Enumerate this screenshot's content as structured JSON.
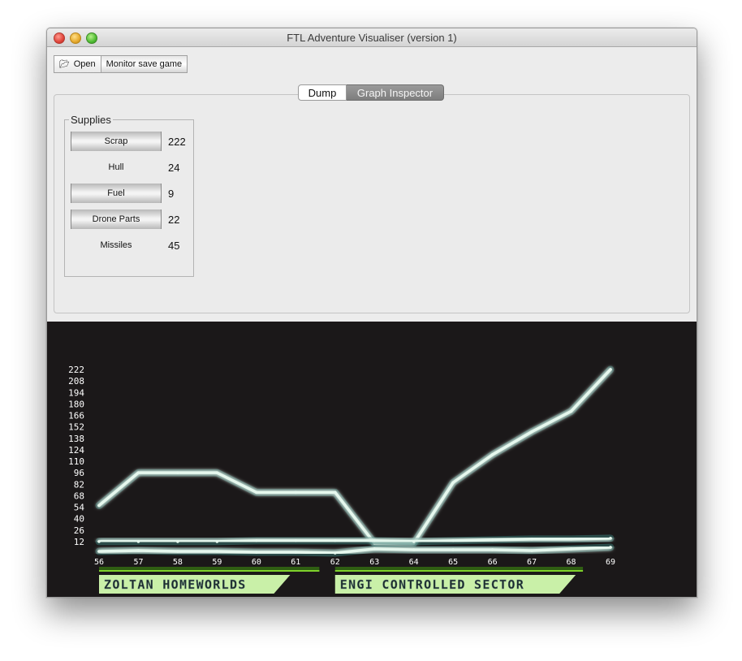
{
  "window": {
    "title": "FTL Adventure Visualiser (version 1)"
  },
  "toolbar": {
    "open_label": "Open",
    "monitor_label": "Monitor save game"
  },
  "tabs": [
    {
      "label": "Dump",
      "selected": false
    },
    {
      "label": "Graph Inspector",
      "selected": true
    }
  ],
  "supplies": {
    "title": "Supplies",
    "items": [
      {
        "label": "Scrap",
        "value": "222"
      },
      {
        "label": "Hull",
        "value": "24"
      },
      {
        "label": "Fuel",
        "value": "9"
      },
      {
        "label": "Drone Parts",
        "value": "22"
      },
      {
        "label": "Missiles",
        "value": "45"
      }
    ]
  },
  "chart_data": {
    "type": "line",
    "x": [
      56,
      57,
      58,
      59,
      60,
      61,
      62,
      63,
      64,
      65,
      66,
      67,
      68,
      69
    ],
    "y_ticks": [
      12,
      26,
      40,
      54,
      68,
      82,
      96,
      110,
      124,
      138,
      152,
      166,
      180,
      194,
      208,
      222
    ],
    "ylim": [
      0,
      222
    ],
    "series": [
      {
        "values": [
          56,
          96,
          96,
          96,
          72,
          72,
          72,
          10,
          10,
          84,
          118,
          146,
          171,
          222
        ]
      },
      {
        "values": [
          12,
          12,
          12,
          12,
          13,
          13,
          13,
          13,
          12,
          13,
          14,
          15,
          15,
          16
        ]
      },
      {
        "values": [
          0,
          1,
          0,
          0,
          -1,
          -1,
          -2,
          3,
          2,
          2,
          2,
          1,
          3,
          5
        ]
      }
    ],
    "sectors": [
      {
        "label": "ZOLTAN HOMEWORLDS",
        "x_start": 56,
        "x_end": 61.6,
        "color": "#c9f0a8"
      },
      {
        "label": "ENGI CONTROLLED SECTOR",
        "x_start": 62,
        "x_end": 68.3,
        "color": "#c9f0a8"
      }
    ],
    "colors": {
      "background": "#1b1819",
      "line": "#e6f8ee",
      "glow": "#3a7a74",
      "text": "#ffffff"
    }
  }
}
